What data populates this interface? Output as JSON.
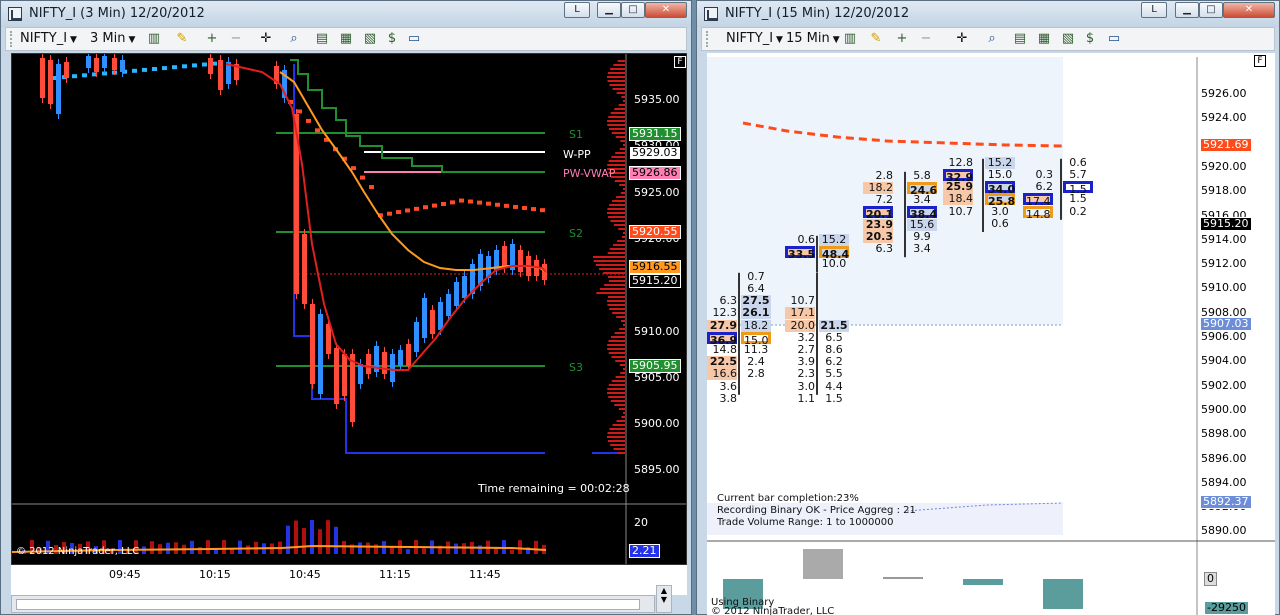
{
  "left_window": {
    "title": "NIFTY_I (3 Min)  12/20/2012",
    "symbol": "NIFTY_I",
    "interval": "3 Min",
    "time_remaining": "Time remaining = 00:02:28",
    "copyright": "© 2012 NinjaTrader, LLC",
    "f_marker": "F",
    "price_ticks": [
      "5935.00",
      "5930.00",
      "5925.00",
      "5920.00",
      "5915.00",
      "5910.00",
      "5905.00",
      "5900.00",
      "5895.00"
    ],
    "time_ticks": [
      "09:45",
      "10:15",
      "10:45",
      "11:15",
      "11:45"
    ],
    "levels": [
      {
        "name": "S1",
        "value": "5931.15",
        "color": "#1f8f2f"
      },
      {
        "name": "W-PP",
        "value": "5929.03",
        "color": "#ffffff"
      },
      {
        "name": "PW-VWAP",
        "value": "5926.86",
        "color": "#ff7fb4"
      },
      {
        "name": "S2",
        "value": "5920.55",
        "color": "#1f8f2f"
      },
      {
        "name": "S3",
        "value": "5905.95",
        "color": "#1f8f2f"
      }
    ],
    "tags": {
      "s1": "5931.15",
      "wpp": "5929.03",
      "pwvwap": "5926.86",
      "s2": "5920.55",
      "last": "5916.55",
      "current": "5915.20",
      "s3": "5905.95"
    },
    "volume_ticks": [
      "20"
    ],
    "volume_tag": "2.21"
  },
  "right_window": {
    "title": "NIFTY_I (15 Min)  12/20/2012",
    "symbol": "NIFTY_I",
    "interval": "15 Min",
    "f_marker": "F",
    "price_ticks": [
      "5926.00",
      "5924.00",
      "5922.00",
      "5920.00",
      "5918.00",
      "5916.00",
      "5914.00",
      "5912.00",
      "5910.00",
      "5908.00",
      "5906.00",
      "5904.00",
      "5902.00",
      "5900.00",
      "5898.00",
      "5896.00",
      "5894.00",
      "5892.00",
      "5890.00"
    ],
    "tags": {
      "vwap": "5921.69",
      "current": "5915.20",
      "low": "5907.03",
      "bottom": "5892.37"
    },
    "info": {
      "completion": "Current bar completion:23%",
      "recording": "Recording Binary OK - Price Aggreg : 21",
      "range": "Trade Volume Range: 1 to 1000000"
    },
    "lower_panel": {
      "label": "Using Binary",
      "copyright": "© 2012 NinjaTrader, LLC",
      "tag_top": "0",
      "tag_bottom": "-29250"
    },
    "footprint": [
      {
        "bid": [
          "",
          "6.3",
          "12.3",
          "27.9",
          "36.9",
          "14.8",
          "22.5",
          "16.6",
          "3.6",
          "3.8"
        ],
        "ask": [
          "0.7",
          "6.4",
          "27.5",
          "26.1",
          "18.2",
          "15.0",
          "11.3",
          "2.4",
          "2.8",
          ""
        ]
      },
      {
        "bid": [
          "",
          "10.7",
          "17.1",
          "20.0",
          "3.2",
          "2.7",
          "3.9",
          "2.3",
          "3.0",
          "1.1"
        ],
        "ask": [
          "",
          "",
          "21.5",
          "6.5",
          "8.6",
          "6.2",
          "5.5",
          "4.4",
          "1.5",
          ""
        ]
      },
      {
        "bid": [
          "0.6",
          "33.5"
        ],
        "ask": [
          "15.2",
          "48.4",
          "10.0"
        ]
      },
      {
        "bid": [
          "2.8",
          "18.2",
          "7.2",
          "20.1",
          "23.9",
          "20.3",
          "6.3"
        ],
        "ask": [
          "5.8",
          "24.6",
          "3.4",
          "38.4",
          "15.6",
          "9.9",
          "3.4"
        ]
      },
      {
        "bid": [
          "12.8",
          "32.9",
          "25.9",
          "18.4",
          "10.7"
        ],
        "ask": [
          "15.2",
          "15.0",
          "34.0",
          "25.8",
          "3.0",
          "0.6"
        ]
      },
      {
        "bid": [
          "0.3",
          "6.2",
          "17.4",
          "14.8"
        ],
        "ask": [
          "0.6",
          "5.7",
          "1.5",
          "1.5",
          "0.2"
        ]
      }
    ]
  },
  "colors": {
    "chart_bg": "#000000",
    "right_bg": "#ffffff",
    "up_bar": "#2f8fff",
    "down_bar": "#ff4b3a",
    "orange_line": "#ff9a1f",
    "red_line": "#e02020",
    "dot_blue": "#29b6ff",
    "dot_red": "#ff4a2a"
  }
}
